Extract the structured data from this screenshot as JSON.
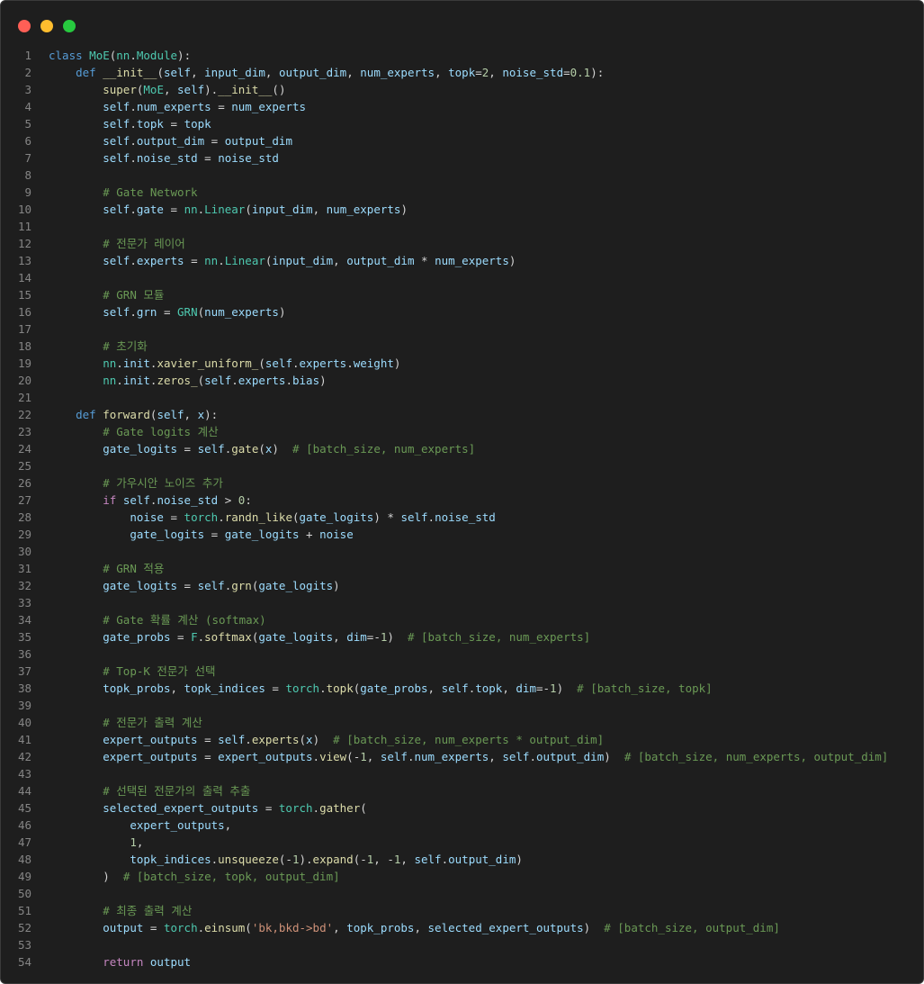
{
  "window": {
    "controls": [
      "close",
      "minimize",
      "maximize"
    ],
    "colors": {
      "close": "#ff5f56",
      "minimize": "#ffbd2e",
      "maximize": "#27c93f",
      "background": "#1e1e1e"
    }
  },
  "code": {
    "language": "python",
    "lines": [
      "class MoE(nn.Module):",
      "    def __init__(self, input_dim, output_dim, num_experts, topk=2, noise_std=0.1):",
      "        super(MoE, self).__init__()",
      "        self.num_experts = num_experts",
      "        self.topk = topk",
      "        self.output_dim = output_dim",
      "        self.noise_std = noise_std",
      "",
      "        # Gate Network",
      "        self.gate = nn.Linear(input_dim, num_experts)",
      "",
      "        # 전문가 레이어",
      "        self.experts = nn.Linear(input_dim, output_dim * num_experts)",
      "",
      "        # GRN 모듈",
      "        self.grn = GRN(num_experts)",
      "",
      "        # 초기화",
      "        nn.init.xavier_uniform_(self.experts.weight)",
      "        nn.init.zeros_(self.experts.bias)",
      "",
      "    def forward(self, x):",
      "        # Gate logits 계산",
      "        gate_logits = self.gate(x)  # [batch_size, num_experts]",
      "",
      "        # 가우시안 노이즈 추가",
      "        if self.noise_std > 0:",
      "            noise = torch.randn_like(gate_logits) * self.noise_std",
      "            gate_logits = gate_logits + noise",
      "",
      "        # GRN 적용",
      "        gate_logits = self.grn(gate_logits)",
      "",
      "        # Gate 확률 계산 (softmax)",
      "        gate_probs = F.softmax(gate_logits, dim=-1)  # [batch_size, num_experts]",
      "",
      "        # Top-K 전문가 선택",
      "        topk_probs, topk_indices = torch.topk(gate_probs, self.topk, dim=-1)  # [batch_size, topk]",
      "",
      "        # 전문가 출력 계산",
      "        expert_outputs = self.experts(x)  # [batch_size, num_experts * output_dim]",
      "        expert_outputs = expert_outputs.view(-1, self.num_experts, self.output_dim)  # [batch_size, num_experts, output_dim]",
      "",
      "        # 선택된 전문가의 출력 추출",
      "        selected_expert_outputs = torch.gather(",
      "            expert_outputs,",
      "            1,",
      "            topk_indices.unsqueeze(-1).expand(-1, -1, self.output_dim)",
      "        )  # [batch_size, topk, output_dim]",
      "",
      "        # 최종 출력 계산",
      "        output = torch.einsum('bk,bkd->bd', topk_probs, selected_expert_outputs)  # [batch_size, output_dim]",
      "",
      "        return output"
    ]
  }
}
